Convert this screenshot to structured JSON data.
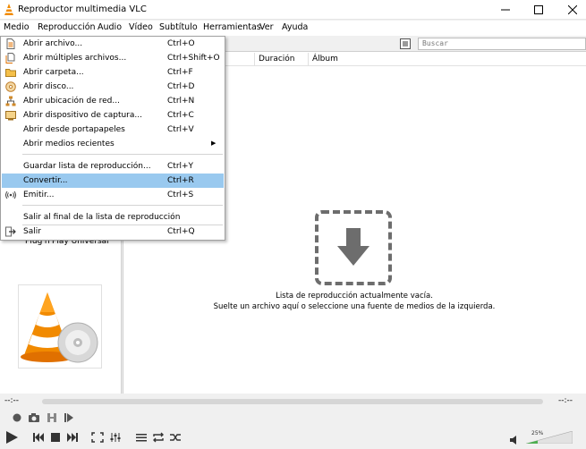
{
  "window": {
    "title": "Reproductor multimedia VLC"
  },
  "menubar": [
    "Medio",
    "Reproducción",
    "Audio",
    "Vídeo",
    "Subtítulo",
    "Herramientas",
    "Ver",
    "Ayuda"
  ],
  "medio_menu": [
    {
      "label": "Abrir archivo...",
      "shortcut": "Ctrl+O",
      "icon": "file-icon"
    },
    {
      "label": "Abrir múltiples archivos...",
      "shortcut": "Ctrl+Shift+O",
      "icon": "files-icon"
    },
    {
      "label": "Abrir carpeta...",
      "shortcut": "Ctrl+F",
      "icon": "folder-icon"
    },
    {
      "label": "Abrir disco...",
      "shortcut": "Ctrl+D",
      "icon": "disc-icon"
    },
    {
      "label": "Abrir ubicación de red...",
      "shortcut": "Ctrl+N",
      "icon": "network-icon"
    },
    {
      "label": "Abrir dispositivo de captura...",
      "shortcut": "Ctrl+C",
      "icon": "capture-icon"
    },
    {
      "label": "Abrir desde portapapeles",
      "shortcut": "Ctrl+V",
      "icon": ""
    },
    {
      "label": "Abrir medios recientes",
      "shortcut": "",
      "icon": "",
      "submenu": true
    },
    {
      "label": "Guardar lista de reproducción...",
      "shortcut": "Ctrl+Y",
      "icon": ""
    },
    {
      "label": "Convertir...",
      "shortcut": "Ctrl+R",
      "icon": "",
      "highlighted": true
    },
    {
      "label": "Emitir...",
      "shortcut": "Ctrl+S",
      "icon": "stream-icon"
    },
    {
      "label": "Salir al final de la lista de reproducción",
      "shortcut": "",
      "icon": ""
    },
    {
      "label": "Salir",
      "shortcut": "Ctrl+Q",
      "icon": "exit-icon"
    }
  ],
  "search": {
    "placeholder": "Buscar"
  },
  "playlist": {
    "columns": [
      "Duración",
      "Álbum"
    ],
    "empty_line1": "Lista de reproducción actualmente vacía.",
    "empty_line2": "Suelte un archivo aquí o seleccione una fuente de medios de la izquierda."
  },
  "sidebar": {
    "visible_item": "Plug'n'Play Universal"
  },
  "player": {
    "time_elapsed": "--:--",
    "time_total": "--:--",
    "volume_percent": "25%"
  },
  "colors": {
    "highlight": "#99c9ef",
    "vlc_orange": "#f18a00"
  }
}
